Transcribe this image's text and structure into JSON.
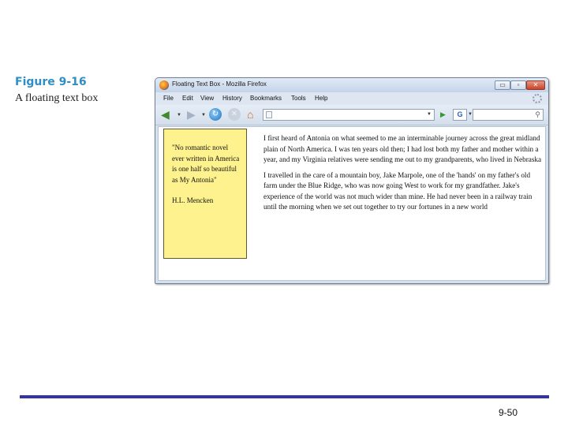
{
  "figure": {
    "label": "Figure 9-16",
    "caption": "A floating text box"
  },
  "browser": {
    "title": "Floating Text Box - Mozilla Firefox",
    "window_buttons": {
      "minimize": "▭",
      "maximize": "▫",
      "close": "✕"
    },
    "menu": [
      "File",
      "Edit",
      "View",
      "History",
      "Bookmarks",
      "Tools",
      "Help"
    ],
    "address_value": "",
    "search_engine": "G"
  },
  "page": {
    "sidebar_quote": "\"No romantic novel ever written in America is one half so beautiful as My Antonia\"",
    "sidebar_author": "H.L. Mencken",
    "paragraphs": [
      "I first heard of Antonia on what seemed to me an interminable journey across the great midland plain of North America. I was ten years old then; I had lost both my father and mother within a year, and my Virginia relatives were sending me out to my grandparents, who lived in Nebraska",
      "I travelled in the care of a mountain boy, Jake Marpole, one of the 'hands' on my father's old farm under the Blue Ridge, who was now going West to work for my grandfather. Jake's experience of the world was not much wider than mine. He had never been in a railway train until the morning when we set out together to try our fortunes in a new world"
    ]
  },
  "slide": {
    "page_number": "9-50"
  },
  "colors": {
    "figure_label": "#2e8fc4",
    "sidebar_bg": "#fdf28e",
    "rule": "#3434a4"
  }
}
